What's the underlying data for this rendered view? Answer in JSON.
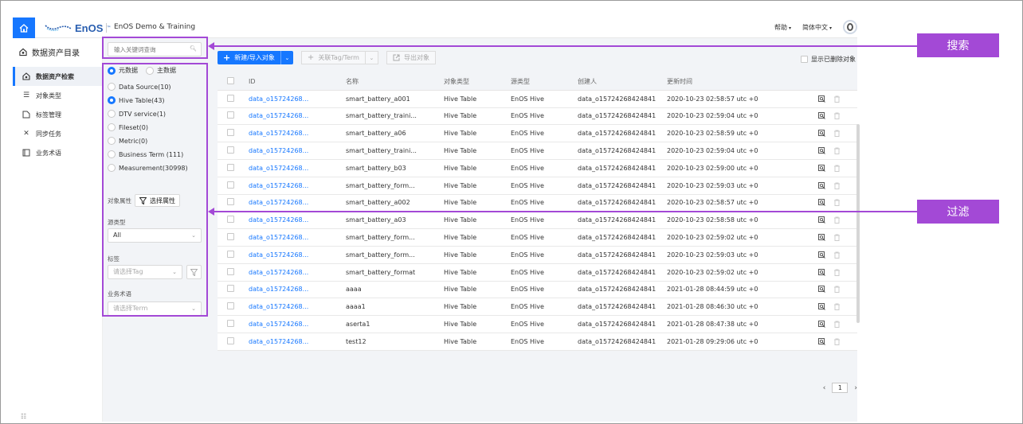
{
  "header": {
    "logo_text": "EnOS",
    "logo_tm": "™",
    "org_name": "EnOS Demo & Training",
    "help_label": "帮助",
    "language_label": "简体中文"
  },
  "leftnav": {
    "title": "数据资产目录",
    "items": [
      {
        "label": "数据资产检索",
        "icon": "catalog-icon",
        "active": true
      },
      {
        "label": "对象类型",
        "icon": "list-icon",
        "active": false
      },
      {
        "label": "标签管理",
        "icon": "tag-icon",
        "active": false
      },
      {
        "label": "同步任务",
        "icon": "sync-icon",
        "active": false
      },
      {
        "label": "业务术语",
        "icon": "book-icon",
        "active": false
      }
    ]
  },
  "filter": {
    "search_placeholder": "输入关键词查询",
    "tabs": [
      {
        "label": "元数据",
        "selected": true
      },
      {
        "label": "主数据",
        "selected": false
      }
    ],
    "object_types": [
      {
        "label": "Data Source(10)",
        "selected": false
      },
      {
        "label": "Hive Table(43)",
        "selected": true
      },
      {
        "label": "DTV service(1)",
        "selected": false
      },
      {
        "label": "Fileset(0)",
        "selected": false
      },
      {
        "label": "Metric(0)",
        "selected": false
      },
      {
        "label": "Business Term (111)",
        "selected": false
      },
      {
        "label": "Measurement(30998)",
        "selected": false
      }
    ],
    "attr_label": "对象属性",
    "attr_button": "选择属性",
    "source_type_label": "源类型",
    "source_type_value": "All",
    "tag_label": "标签",
    "tag_placeholder": "请选择Tag",
    "term_label": "业务术语",
    "term_placeholder": "请选择Term"
  },
  "toolbar": {
    "new_import": "新建/导入对象",
    "link_tag": "关联Tag/Term",
    "export": "导出对象",
    "show_deleted": "显示已删除对象"
  },
  "table": {
    "columns": [
      "ID",
      "名称",
      "对象类型",
      "源类型",
      "创建人",
      "更新时间"
    ],
    "rows": [
      {
        "id": "data_o15724268...",
        "name": "smart_battery_a001",
        "otype": "Hive Table",
        "stype": "EnOS Hive",
        "creator": "data_o15724268424841",
        "time": "2020-10-23 02:58:57 utc +0"
      },
      {
        "id": "data_o15724268...",
        "name": "smart_battery_traini...",
        "otype": "Hive Table",
        "stype": "EnOS Hive",
        "creator": "data_o15724268424841",
        "time": "2020-10-23 02:59:04 utc +0"
      },
      {
        "id": "data_o15724268...",
        "name": "smart_battery_a06",
        "otype": "Hive Table",
        "stype": "EnOS Hive",
        "creator": "data_o15724268424841",
        "time": "2020-10-23 02:58:59 utc +0"
      },
      {
        "id": "data_o15724268...",
        "name": "smart_battery_traini...",
        "otype": "Hive Table",
        "stype": "EnOS Hive",
        "creator": "data_o15724268424841",
        "time": "2020-10-23 02:59:04 utc +0"
      },
      {
        "id": "data_o15724268...",
        "name": "smart_battery_b03",
        "otype": "Hive Table",
        "stype": "EnOS Hive",
        "creator": "data_o15724268424841",
        "time": "2020-10-23 02:59:00 utc +0"
      },
      {
        "id": "data_o15724268...",
        "name": "smart_battery_form...",
        "otype": "Hive Table",
        "stype": "EnOS Hive",
        "creator": "data_o15724268424841",
        "time": "2020-10-23 02:59:03 utc +0"
      },
      {
        "id": "data_o15724268...",
        "name": "smart_battery_a002",
        "otype": "Hive Table",
        "stype": "EnOS Hive",
        "creator": "data_o15724268424841",
        "time": "2020-10-23 02:58:57 utc +0"
      },
      {
        "id": "data_o15724268...",
        "name": "smart_battery_a03",
        "otype": "Hive Table",
        "stype": "EnOS Hive",
        "creator": "data_o15724268424841",
        "time": "2020-10-23 02:58:58 utc +0"
      },
      {
        "id": "data_o15724268...",
        "name": "smart_battery_form...",
        "otype": "Hive Table",
        "stype": "EnOS Hive",
        "creator": "data_o15724268424841",
        "time": "2020-10-23 02:59:02 utc +0"
      },
      {
        "id": "data_o15724268...",
        "name": "smart_battery_form...",
        "otype": "Hive Table",
        "stype": "EnOS Hive",
        "creator": "data_o15724268424841",
        "time": "2020-10-23 02:59:03 utc +0"
      },
      {
        "id": "data_o15724268...",
        "name": "smart_battery_format",
        "otype": "Hive Table",
        "stype": "EnOS Hive",
        "creator": "data_o15724268424841",
        "time": "2020-10-23 02:59:02 utc +0"
      },
      {
        "id": "data_o15724268...",
        "name": "aaaa",
        "otype": "Hive Table",
        "stype": "EnOS Hive",
        "creator": "data_o15724268424841",
        "time": "2021-01-28 08:44:59 utc +0"
      },
      {
        "id": "data_o15724268...",
        "name": "aaaa1",
        "otype": "Hive Table",
        "stype": "EnOS Hive",
        "creator": "data_o15724268424841",
        "time": "2021-01-28 08:46:30 utc +0"
      },
      {
        "id": "data_o15724268...",
        "name": "aserta1",
        "otype": "Hive Table",
        "stype": "EnOS Hive",
        "creator": "data_o15724268424841",
        "time": "2021-01-28 08:47:38 utc +0"
      },
      {
        "id": "data_o15724268...",
        "name": "test12",
        "otype": "Hive Table",
        "stype": "EnOS Hive",
        "creator": "data_o15724268424841",
        "time": "2021-01-28 09:29:06 utc +0"
      }
    ]
  },
  "pagination": {
    "current_page": "1"
  },
  "annotations": {
    "search_label": "搜索",
    "filter_label": "过滤",
    "color": "#a349d6"
  },
  "colors": {
    "accent": "#1677ff",
    "annotation": "#a349d6"
  }
}
